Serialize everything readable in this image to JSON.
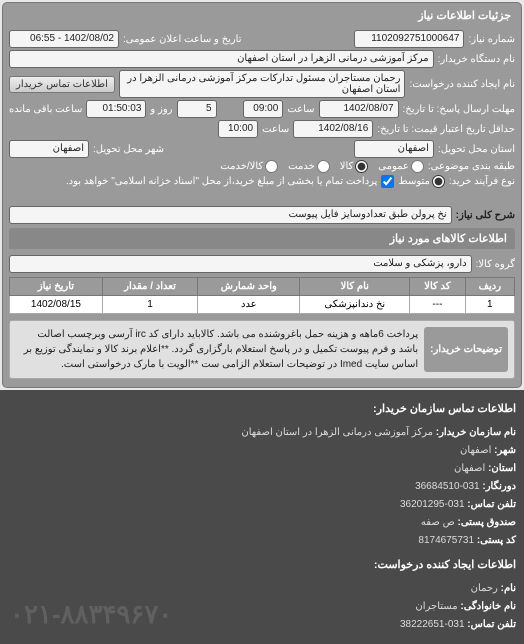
{
  "panel_title": "جزئیات اطلاعات نیاز",
  "reqno": {
    "label": "شماره نیاز:",
    "value": "1102092751000647"
  },
  "pubdate": {
    "label": "تاریخ و ساعت اعلان عمومی:",
    "value": "1402/08/02 - 06:55"
  },
  "buyer": {
    "label": "نام دستگاه خریدار:",
    "value": "مرکز آموزشی درمانی الزهرا در استان اصفهان"
  },
  "requester": {
    "label": "نام ایجاد کننده درخواست:",
    "value": "رحمان مستاجران مسئول تدارکات مرکز آموزشی درمانی الزهرا در استان اصفهان"
  },
  "contact_btn": "اطلاعات تماس خریدار",
  "deadline": {
    "label": "مهلت ارسال پاسخ: تا تاریخ:",
    "date": "1402/08/07",
    "time_label": "ساعت",
    "time": "09:00",
    "and": "و",
    "days": "5",
    "days_label": "روز و",
    "remain": "01:50:03",
    "remain_label": "ساعت باقی مانده"
  },
  "validity": {
    "label": "حداقل تاریخ اعتبار قیمت: تا تاریخ:",
    "date": "1402/08/16",
    "time_label": "ساعت",
    "time": "10:00"
  },
  "province": {
    "label": "استان محل تحویل:",
    "value": "اصفهان"
  },
  "city": {
    "label": "شهر محل تحویل:",
    "value": "اصفهان"
  },
  "group": {
    "label": "طبقه بندی موضوعی:",
    "options": [
      "عمومی",
      "کالا",
      "خدمت",
      "کالا/خدمت"
    ],
    "selected": "کالا"
  },
  "process": {
    "label": "نوع فرآیند خرید:",
    "options": [
      "متوسط"
    ],
    "selected": "متوسط",
    "note": "پرداخت تمام یا بخشی از مبلغ خرید،از محل \"اسناد خزانه اسلامی\" خواهد بود."
  },
  "pay_checkbox": {
    "checked": true
  },
  "desc": {
    "label": "شرح کلی نیاز:",
    "value": "نخ پرولن طبق تعدادوسایز فایل پیوست"
  },
  "items_header": "اطلاعات کالاهای مورد نیاز",
  "item_group": {
    "label": "گروه کالا:",
    "value": "دارو، پزشکی و سلامت"
  },
  "table": {
    "headers": [
      "ردیف",
      "کد کالا",
      "نام کالا",
      "واحد شمارش",
      "تعداد / مقدار",
      "تاریخ نیاز"
    ],
    "rows": [
      {
        "idx": "1",
        "code": "---",
        "name": "نخ دندانپزشکی",
        "unit": "عدد",
        "qty": "1",
        "date": "1402/08/15"
      }
    ]
  },
  "buyer_notes": {
    "label": "توضیحات خریدار:",
    "text": "پرداخت 6ماهه و هزینه حمل باغروشنده می باشد. کالاباید دارای کد irc آرسی وبرچسب اصالت باشد و فرم پیوست تکمیل و در پاسخ استعلام بارگزاری گردد. **اعلام برند کالا و نمایندگی توزیع بر اساس سایت Imed در توضیحات استعلام الزامی ست **الویت با مارک درخواستی است."
  },
  "contact_section": {
    "heading": "اطلاعات تماس سازمان خریدار:",
    "org": {
      "label": "نام سازمان خریدار:",
      "value": "مرکز آموزشی درمانی الزهرا در استان اصفهان"
    },
    "city": {
      "label": "شهر:",
      "value": "اصفهان"
    },
    "province": {
      "label": "استان:",
      "value": "اصفهان"
    },
    "fax": {
      "label": "دورنگار:",
      "value": "031-36684510"
    },
    "tel": {
      "label": "تلفن تماس:",
      "value": "031-36201295"
    },
    "postbox": {
      "label": "صندوق پستی:",
      "value": "ص صفه"
    },
    "postcode": {
      "label": "کد پستی:",
      "value": "8174675731"
    },
    "subheading": "اطلاعات ایجاد کننده درخواست:",
    "name": {
      "label": "نام:",
      "value": "رحمان"
    },
    "family": {
      "label": "نام خانوادگی:",
      "value": "مستاجران"
    },
    "phone": {
      "label": "تلفن تماس:",
      "value": "031-38222651"
    }
  },
  "watermark": "۰۲۱-۸۸۳۴۹۶۷۰"
}
